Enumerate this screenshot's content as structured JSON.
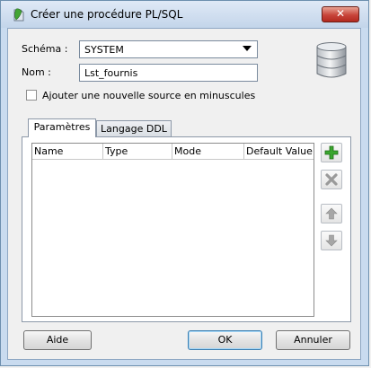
{
  "window": {
    "title": "Créer une procédure PL/SQL",
    "close_label": "✕"
  },
  "form": {
    "schema_label": "Schéma :",
    "schema_value": "SYSTEM",
    "name_label": "Nom :",
    "name_value": "Lst_fournis",
    "lowercase_checkbox_label": "Ajouter une nouvelle source en minuscules",
    "lowercase_checked": false
  },
  "tabs": [
    {
      "label": "Paramètres",
      "active": true
    },
    {
      "label": "Langage DDL",
      "active": false
    }
  ],
  "parameters_table": {
    "columns": [
      "Name",
      "Type",
      "Mode",
      "Default Value"
    ],
    "rows": []
  },
  "side_buttons": [
    {
      "icon": "add-icon",
      "enabled": true
    },
    {
      "icon": "remove-icon",
      "enabled": false
    },
    {
      "icon": "move-up-icon",
      "enabled": false
    },
    {
      "icon": "move-down-icon",
      "enabled": false
    }
  ],
  "footer": {
    "help_label": "Aide",
    "ok_label": "OK",
    "cancel_label": "Annuler"
  },
  "colors": {
    "add_green": "#3aa62e",
    "disabled_gray": "#9a9a9a",
    "close_red": "#c8453a"
  }
}
